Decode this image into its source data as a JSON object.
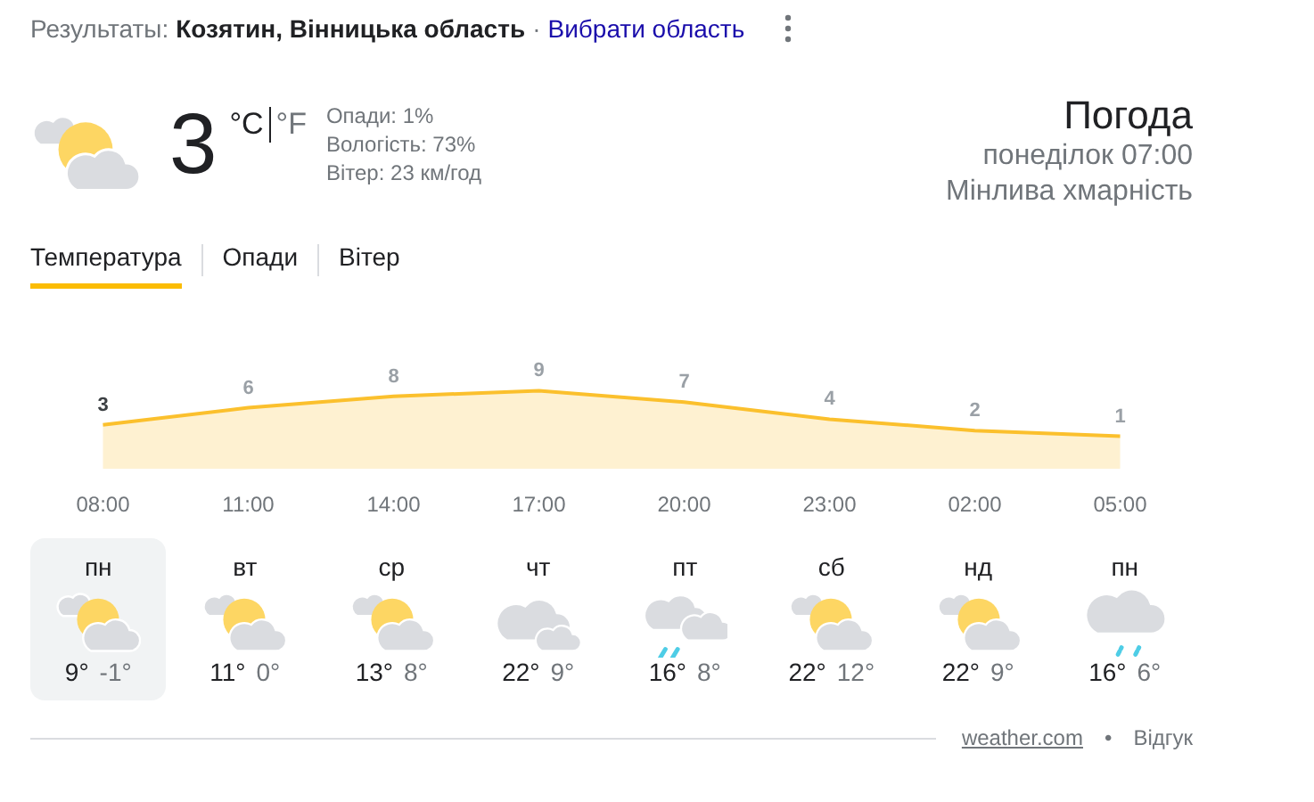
{
  "header": {
    "prefix": "Результаты:",
    "location": "Козятин, Вінницька область",
    "separator": "·",
    "link": "Вибрати область"
  },
  "current": {
    "kind": "partly",
    "temperature": "3",
    "units": [
      {
        "label": "°C",
        "selected": true
      },
      {
        "label": "°F",
        "selected": false
      }
    ],
    "details": [
      "Опади: 1%",
      "Вологість: 73%",
      "Вітер: 23 км/год"
    ]
  },
  "summary": {
    "title": "Погода",
    "time": "понеділок 07:00",
    "condition": "Мінлива хмарність"
  },
  "tabs": [
    {
      "label": "Температура",
      "selected": true
    },
    {
      "label": "Опади",
      "selected": false
    },
    {
      "label": "Вітер",
      "selected": false
    }
  ],
  "chart_data": {
    "type": "area",
    "categories": [
      "08:00",
      "11:00",
      "14:00",
      "17:00",
      "20:00",
      "23:00",
      "02:00",
      "05:00"
    ],
    "series": [
      {
        "color": "#fbc02d",
        "values": [
          3,
          6,
          8,
          9,
          7,
          4,
          2,
          1
        ]
      }
    ],
    "data_labels": true
  },
  "days": [
    {
      "day": "пн",
      "kind": "partly",
      "high": "9°",
      "low": "-1°",
      "selected": true
    },
    {
      "day": "вт",
      "kind": "partly",
      "high": "11°",
      "low": "0°",
      "selected": false
    },
    {
      "day": "ср",
      "kind": "partly",
      "high": "13°",
      "low": "8°",
      "selected": false
    },
    {
      "day": "чт",
      "kind": "cloudy",
      "high": "22°",
      "low": "9°",
      "selected": false
    },
    {
      "day": "пт",
      "kind": "rain-partly",
      "high": "16°",
      "low": "8°",
      "selected": false
    },
    {
      "day": "сб",
      "kind": "partly",
      "high": "22°",
      "low": "12°",
      "selected": false
    },
    {
      "day": "нд",
      "kind": "partly",
      "high": "22°",
      "low": "9°",
      "selected": false
    },
    {
      "day": "пн",
      "kind": "rain",
      "high": "16°",
      "low": "6°",
      "selected": false
    }
  ],
  "footer": {
    "source": "weather.com",
    "separator": "•",
    "feedback": "Відгук"
  }
}
